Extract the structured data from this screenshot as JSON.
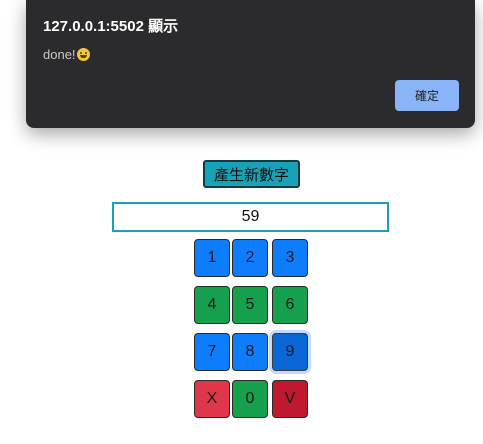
{
  "alert": {
    "title": "127.0.0.1:5502 顯示",
    "message": "done!",
    "message_emoji": "grinning-face-emoji",
    "ok_label": "確定"
  },
  "generator": {
    "button_label": "產生新數字"
  },
  "input": {
    "value": "59"
  },
  "keypad": {
    "rows": [
      [
        "1",
        "2",
        "3"
      ],
      [
        "4",
        "5",
        "6"
      ],
      [
        "7",
        "8",
        "9"
      ],
      [
        "X",
        "0",
        "V"
      ]
    ]
  },
  "colors": {
    "alert_bg": "#2b2b2d",
    "alert_ok": "#8ab4f8",
    "generate_button": "#17a2b8",
    "key_blue": "#0d7dfd",
    "key_green": "#14a04d",
    "key_red": "#e0364a",
    "key_darkred": "#c0182e"
  }
}
